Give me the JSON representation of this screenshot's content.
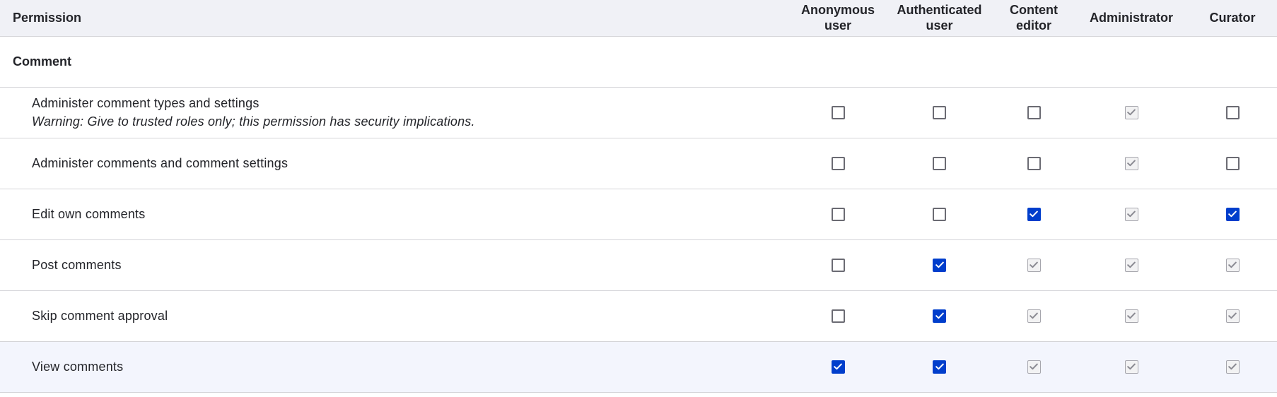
{
  "table": {
    "permission_header": "Permission",
    "roles": [
      {
        "key": "anon",
        "label_line1": "Anonymous",
        "label_line2": "user"
      },
      {
        "key": "auth",
        "label_line1": "Authenticated",
        "label_line2": "user"
      },
      {
        "key": "editor",
        "label_line1": "Content",
        "label_line2": "editor"
      },
      {
        "key": "admin",
        "label_line1": "Administrator",
        "label_line2": ""
      },
      {
        "key": "curator",
        "label_line1": "Curator",
        "label_line2": ""
      }
    ],
    "module": "Comment",
    "rows": [
      {
        "title": "Administer comment types and settings",
        "warning": "Warning: Give to trusted roles only; this permission has security implications.",
        "states": [
          "unchecked",
          "unchecked",
          "unchecked",
          "disabled",
          "unchecked"
        ]
      },
      {
        "title": "Administer comments and comment settings",
        "warning": "",
        "states": [
          "unchecked",
          "unchecked",
          "unchecked",
          "disabled",
          "unchecked"
        ]
      },
      {
        "title": "Edit own comments",
        "warning": "",
        "states": [
          "unchecked",
          "unchecked",
          "checked",
          "disabled",
          "checked"
        ]
      },
      {
        "title": "Post comments",
        "warning": "",
        "states": [
          "unchecked",
          "checked",
          "disabled",
          "disabled",
          "disabled"
        ]
      },
      {
        "title": "Skip comment approval",
        "warning": "",
        "states": [
          "unchecked",
          "checked",
          "disabled",
          "disabled",
          "disabled"
        ]
      },
      {
        "title": "View comments",
        "warning": "",
        "states": [
          "checked",
          "checked",
          "disabled",
          "disabled",
          "disabled"
        ],
        "highlighted": true
      }
    ]
  },
  "icons": {
    "checked": "check-icon",
    "disabled": "check-icon"
  },
  "colors": {
    "accent": "#003ecc",
    "header_bg": "#f0f1f6",
    "highlight_row_bg": "#f3f5fd",
    "border": "#d4d4d8"
  }
}
